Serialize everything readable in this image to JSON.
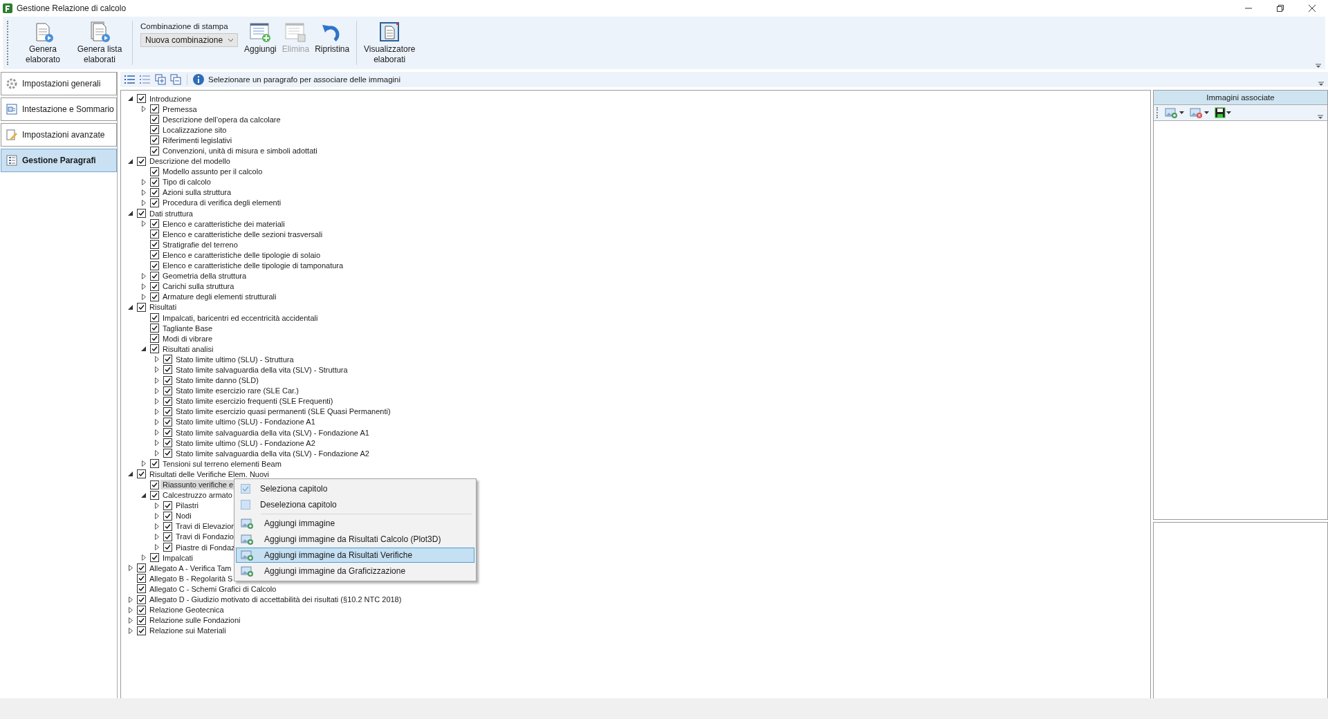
{
  "window": {
    "title": "Gestione Relazione di calcolo"
  },
  "toolbar": {
    "buttons": [
      {
        "kind": "genera",
        "label": "Genera elaborato",
        "disabled": false
      },
      {
        "kind": "lista",
        "label": "Genera lista elaborati",
        "disabled": false
      }
    ],
    "combo_group": {
      "label": "Combinazione di stampa",
      "value": "Nuova combinazione"
    },
    "actions": [
      {
        "kind": "aggiungi",
        "label": "Aggiungi",
        "disabled": false
      },
      {
        "kind": "elimina",
        "label": "Elimina",
        "disabled": true
      },
      {
        "kind": "ripristina",
        "label": "Ripristina",
        "disabled": false
      }
    ],
    "viewer": {
      "kind": "viewer",
      "label": "Visualizzatore elaborati",
      "disabled": false
    }
  },
  "sidebar": {
    "items": [
      {
        "kind": "gear",
        "label": "Impostazioni generali",
        "selected": false
      },
      {
        "kind": "header",
        "label": "Intestazione e Sommario",
        "selected": false
      },
      {
        "kind": "pencil",
        "label": "Impostazioni avanzate",
        "selected": false
      },
      {
        "kind": "tree",
        "label": "Gestione Paragrafi",
        "selected": true
      }
    ]
  },
  "hint": "Selezionare un paragrafo per associare delle immagini",
  "tree": [
    {
      "label": "Introduzione",
      "checked": true,
      "has_children": true,
      "expanded": true,
      "selected": false,
      "children": [
        {
          "label": "Premessa",
          "checked": true,
          "has_children": true,
          "expanded": false,
          "selected": false
        },
        {
          "label": "Descrizione dell’opera da calcolare",
          "checked": true,
          "has_children": false,
          "expanded": false,
          "selected": false
        },
        {
          "label": "Localizzazione sito",
          "checked": true,
          "has_children": false,
          "expanded": false,
          "selected": false
        },
        {
          "label": "Riferimenti legislativi",
          "checked": true,
          "has_children": false,
          "expanded": false,
          "selected": false
        },
        {
          "label": "Convenzioni, unità di misura e simboli adottati",
          "checked": true,
          "has_children": false,
          "expanded": false,
          "selected": false
        }
      ]
    },
    {
      "label": "Descrizione del modello",
      "checked": true,
      "has_children": true,
      "expanded": true,
      "selected": false,
      "children": [
        {
          "label": "Modello assunto per il calcolo",
          "checked": true,
          "has_children": false,
          "expanded": false,
          "selected": false
        },
        {
          "label": "Tipo di calcolo",
          "checked": true,
          "has_children": true,
          "expanded": false,
          "selected": false
        },
        {
          "label": "Azioni sulla struttura",
          "checked": true,
          "has_children": true,
          "expanded": false,
          "selected": false
        },
        {
          "label": "Procedura di verifica degli elementi",
          "checked": true,
          "has_children": true,
          "expanded": false,
          "selected": false
        }
      ]
    },
    {
      "label": "Dati struttura",
      "checked": true,
      "has_children": true,
      "expanded": true,
      "selected": false,
      "children": [
        {
          "label": "Elenco e caratteristiche dei materiali",
          "checked": true,
          "has_children": true,
          "expanded": false,
          "selected": false
        },
        {
          "label": "Elenco e caratteristiche delle sezioni trasversali",
          "checked": true,
          "has_children": false,
          "expanded": false,
          "selected": false
        },
        {
          "label": "Stratigrafie del terreno",
          "checked": true,
          "has_children": false,
          "expanded": false,
          "selected": false
        },
        {
          "label": "Elenco e caratteristiche delle tipologie di solaio",
          "checked": true,
          "has_children": false,
          "expanded": false,
          "selected": false
        },
        {
          "label": "Elenco e caratteristiche delle tipologie di tamponatura",
          "checked": true,
          "has_children": false,
          "expanded": false,
          "selected": false
        },
        {
          "label": "Geometria della struttura",
          "checked": true,
          "has_children": true,
          "expanded": false,
          "selected": false
        },
        {
          "label": "Carichi sulla struttura",
          "checked": true,
          "has_children": true,
          "expanded": false,
          "selected": false
        },
        {
          "label": "Armature degli elementi strutturali",
          "checked": true,
          "has_children": true,
          "expanded": false,
          "selected": false
        }
      ]
    },
    {
      "label": "Risultati",
      "checked": true,
      "has_children": true,
      "expanded": true,
      "selected": false,
      "children": [
        {
          "label": "Impalcati, baricentri ed eccentricità accidentali",
          "checked": true,
          "has_children": false,
          "expanded": false,
          "selected": false
        },
        {
          "label": "Tagliante Base",
          "checked": true,
          "has_children": false,
          "expanded": false,
          "selected": false
        },
        {
          "label": "Modi di vibrare",
          "checked": true,
          "has_children": false,
          "expanded": false,
          "selected": false
        },
        {
          "label": "Risultati analisi",
          "checked": true,
          "has_children": true,
          "expanded": true,
          "selected": false,
          "children": [
            {
              "label": "Stato limite ultimo (SLU) - Struttura",
              "checked": true,
              "has_children": true,
              "expanded": false,
              "selected": false
            },
            {
              "label": "Stato limite salvaguardia della vita (SLV) - Struttura",
              "checked": true,
              "has_children": true,
              "expanded": false,
              "selected": false
            },
            {
              "label": "Stato limite danno (SLD)",
              "checked": true,
              "has_children": true,
              "expanded": false,
              "selected": false
            },
            {
              "label": "Stato limite esercizio rare (SLE Car.)",
              "checked": true,
              "has_children": true,
              "expanded": false,
              "selected": false
            },
            {
              "label": "Stato limite esercizio frequenti (SLE Frequenti)",
              "checked": true,
              "has_children": true,
              "expanded": false,
              "selected": false
            },
            {
              "label": "Stato limite esercizio quasi permanenti (SLE Quasi Permanenti)",
              "checked": true,
              "has_children": true,
              "expanded": false,
              "selected": false
            },
            {
              "label": "Stato limite ultimo (SLU) - Fondazione A1",
              "checked": true,
              "has_children": true,
              "expanded": false,
              "selected": false
            },
            {
              "label": "Stato limite salvaguardia della vita (SLV) - Fondazione A1",
              "checked": true,
              "has_children": true,
              "expanded": false,
              "selected": false
            },
            {
              "label": "Stato limite ultimo (SLU) - Fondazione A2",
              "checked": true,
              "has_children": true,
              "expanded": false,
              "selected": false
            },
            {
              "label": "Stato limite salvaguardia della vita (SLV) - Fondazione A2",
              "checked": true,
              "has_children": true,
              "expanded": false,
              "selected": false
            }
          ]
        },
        {
          "label": "Tensioni sul terreno elementi Beam",
          "checked": true,
          "has_children": true,
          "expanded": false,
          "selected": false
        }
      ]
    },
    {
      "label": "Risultati delle Verifiche Elem. Nuovi",
      "checked": true,
      "has_children": true,
      "expanded": true,
      "selected": false,
      "children": [
        {
          "label": "Riassunto verifiche e",
          "checked": true,
          "has_children": false,
          "expanded": false,
          "selected": true
        },
        {
          "label": "Calcestruzzo armato",
          "checked": true,
          "has_children": true,
          "expanded": true,
          "selected": false,
          "children": [
            {
              "label": "Pilastri",
              "checked": true,
              "has_children": true,
              "expanded": false,
              "selected": false
            },
            {
              "label": "Nodi",
              "checked": true,
              "has_children": true,
              "expanded": false,
              "selected": false
            },
            {
              "label": "Travi di Elevazion",
              "checked": true,
              "has_children": true,
              "expanded": false,
              "selected": false
            },
            {
              "label": "Travi di Fondazio",
              "checked": true,
              "has_children": true,
              "expanded": false,
              "selected": false
            },
            {
              "label": "Piastre di Fondaz",
              "checked": true,
              "has_children": true,
              "expanded": false,
              "selected": false
            }
          ]
        },
        {
          "label": "Impalcati",
          "checked": true,
          "has_children": true,
          "expanded": false,
          "selected": false
        }
      ]
    },
    {
      "label": "Allegato A - Verifica Tam",
      "checked": true,
      "has_children": true,
      "expanded": false,
      "selected": false
    },
    {
      "label": "Allegato B - Regolarità S",
      "checked": true,
      "has_children": false,
      "expanded": false,
      "selected": false
    },
    {
      "label": "Allegato C - Schemi Grafici di Calcolo",
      "checked": true,
      "has_children": false,
      "expanded": false,
      "selected": false
    },
    {
      "label": "Allegato D - Giudizio motivato di accettabilità dei risultati (§10.2 NTC 2018)",
      "checked": true,
      "has_children": true,
      "expanded": false,
      "selected": false
    },
    {
      "label": "Relazione Geotecnica",
      "checked": true,
      "has_children": true,
      "expanded": false,
      "selected": false
    },
    {
      "label": "Relazione sulle Fondazioni",
      "checked": true,
      "has_children": true,
      "expanded": false,
      "selected": false
    },
    {
      "label": "Relazione sui Materiali",
      "checked": true,
      "has_children": true,
      "expanded": false,
      "selected": false
    }
  ],
  "context_menu": {
    "items": [
      {
        "kind": "checked",
        "label": "Seleziona capitolo",
        "selected": false
      },
      {
        "kind": "unchecked",
        "label": "Deseleziona capitolo",
        "selected": false
      },
      {
        "kind": "separator"
      },
      {
        "kind": "image",
        "label": "Aggiungi immagine",
        "selected": false
      },
      {
        "kind": "image",
        "label": "Aggiungi immagine da Risultati Calcolo (Plot3D)",
        "selected": false
      },
      {
        "kind": "image",
        "label": "Aggiungi immagine da Risultati Verifiche",
        "selected": true
      },
      {
        "kind": "image",
        "label": "Aggiungi immagine da Graficizzazione",
        "selected": false
      }
    ]
  },
  "images_panel": {
    "title": "Immagini associate",
    "tools": [
      {
        "kind": "add"
      },
      {
        "kind": "remove"
      },
      {
        "kind": "save"
      }
    ]
  }
}
